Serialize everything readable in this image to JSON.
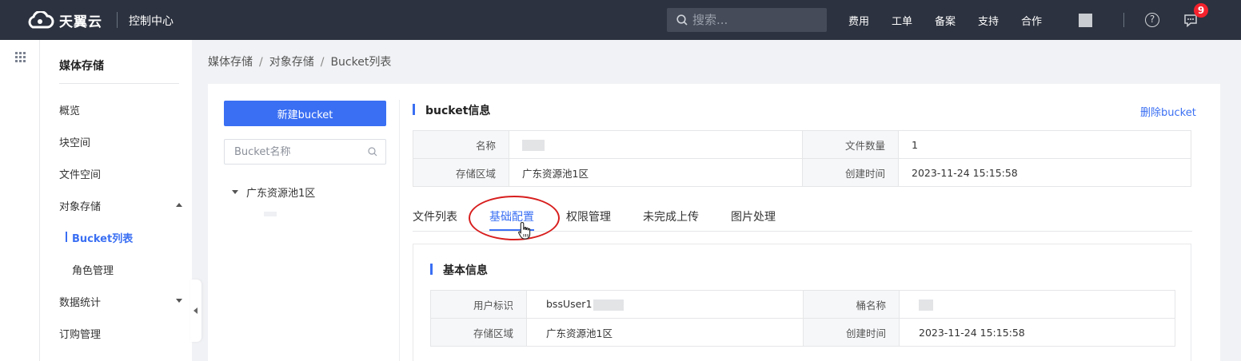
{
  "topbar": {
    "brand": "天翼云",
    "console": "控制中心",
    "search_placeholder": "搜索...",
    "nav": [
      "费用",
      "工单",
      "备案",
      "支持",
      "合作"
    ],
    "help_icon": "?",
    "message_count": "9"
  },
  "sidebar": {
    "title": "媒体存储",
    "items": [
      {
        "label": "概览"
      },
      {
        "label": "块空间"
      },
      {
        "label": "文件空间"
      },
      {
        "label": "对象存储",
        "expanded": true
      },
      {
        "label": "Bucket列表",
        "active": true
      },
      {
        "label": "角色管理"
      },
      {
        "label": "数据统计"
      },
      {
        "label": "订购管理"
      }
    ]
  },
  "breadcrumb": [
    "媒体存储",
    "对象存储",
    "Bucket列表"
  ],
  "bucket_panel": {
    "new_button": "新建bucket",
    "search_placeholder": "Bucket名称",
    "tree_root": "广东资源池1区"
  },
  "bucket_info": {
    "title": "bucket信息",
    "delete_link": "删除bucket",
    "rows": [
      {
        "k1": "名称",
        "v1": "",
        "k2": "文件数量",
        "v2": "1"
      },
      {
        "k1": "存储区域",
        "v1": "广东资源池1区",
        "k2": "创建时间",
        "v2": "2023-11-24 15:15:58"
      }
    ]
  },
  "tabs": [
    "文件列表",
    "基础配置",
    "权限管理",
    "未完成上传",
    "图片处理"
  ],
  "active_tab": "基础配置",
  "basic_info": {
    "title": "基本信息",
    "rows": [
      {
        "k1": "用户标识",
        "v1": "bssUser1",
        "k2": "桶名称",
        "v2": ""
      },
      {
        "k1": "存储区域",
        "v1": "广东资源池1区",
        "k2": "创建时间",
        "v2": "2023-11-24 15:15:58"
      }
    ]
  },
  "colors": {
    "accent": "#3a6ff3",
    "topbar": "#2c323f",
    "annotation": "#d81e1e"
  }
}
